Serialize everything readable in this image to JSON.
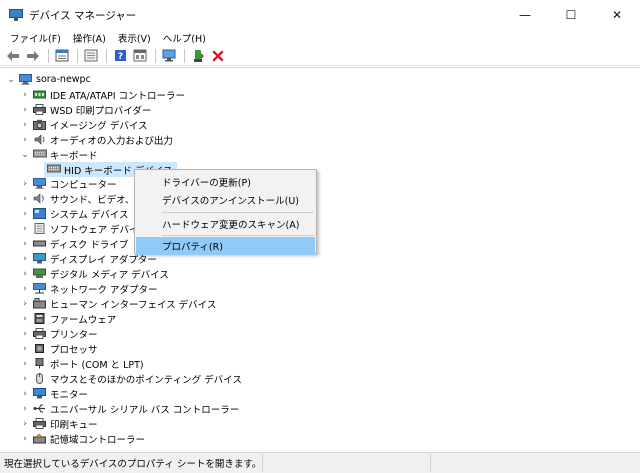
{
  "window": {
    "title": "デバイス マネージャー",
    "minimize_glyph": "—",
    "maximize_glyph": "☐",
    "close_glyph": "✕"
  },
  "menu": [
    "ファイル(F)",
    "操作(A)",
    "表示(V)",
    "ヘルプ(H)"
  ],
  "toolbar": {
    "icons": [
      "back-arrow-icon",
      "forward-arrow-icon",
      "properties-sheet-icon",
      "show-hidden-icon",
      "help-icon",
      "device-view-icon",
      "scan-hardware-icon",
      "enable-device-icon",
      "uninstall-x-icon"
    ]
  },
  "tree": {
    "root": "sora-newpc",
    "expanded_category": "キーボード",
    "selected_device": "HID キーボード デバイス",
    "categories_before": [
      {
        "label": "IDE ATA/ATAPI コントローラー",
        "icon": "ide-controller-icon"
      },
      {
        "label": "WSD 印刷プロバイダー",
        "icon": "printer-icon"
      },
      {
        "label": "イメージング デバイス",
        "icon": "camera-icon"
      },
      {
        "label": "オーディオの入力および出力",
        "icon": "speaker-icon"
      }
    ],
    "categories_after": [
      {
        "label": "コンピューター",
        "icon": "computer-icon"
      },
      {
        "label": "サウンド、ビデオ、およ",
        "icon": "sound-icon"
      },
      {
        "label": "システム デバイス",
        "icon": "system-device-icon"
      },
      {
        "label": "ソフトウェア デバイス",
        "icon": "software-device-icon"
      },
      {
        "label": "ディスク ドライブ",
        "icon": "disk-drive-icon"
      },
      {
        "label": "ディスプレイ アダプター",
        "icon": "display-adapter-icon"
      },
      {
        "label": "デジタル メディア デバイス",
        "icon": "media-device-icon"
      },
      {
        "label": "ネットワーク アダプター",
        "icon": "network-adapter-icon"
      },
      {
        "label": "ヒューマン インターフェイス デバイス",
        "icon": "hid-icon"
      },
      {
        "label": "ファームウェア",
        "icon": "firmware-icon"
      },
      {
        "label": "プリンター",
        "icon": "printer-icon"
      },
      {
        "label": "プロセッサ",
        "icon": "processor-icon"
      },
      {
        "label": "ポート (COM と LPT)",
        "icon": "port-icon"
      },
      {
        "label": "マウスとそのほかのポインティング デバイス",
        "icon": "mouse-icon"
      },
      {
        "label": "モニター",
        "icon": "monitor-icon"
      },
      {
        "label": "ユニバーサル シリアル バス コントローラー",
        "icon": "usb-icon"
      },
      {
        "label": "印刷キュー",
        "icon": "print-queue-icon"
      },
      {
        "label": "記憶域コントローラー",
        "icon": "storage-controller-icon"
      }
    ]
  },
  "context_menu": {
    "items": [
      {
        "label": "ドライバーの更新(P)"
      },
      {
        "label": "デバイスのアンインストール(U)"
      },
      {
        "label": "ハードウェア変更のスキャン(A)"
      },
      {
        "label": "プロパティ(R)"
      }
    ],
    "highlighted_index": 3
  },
  "status": {
    "text": "現在選択しているデバイスのプロパティ シートを開きます。"
  },
  "colors": {
    "highlight": "#91c9f7",
    "selected_item": "#cce8ff",
    "uninstall_red": "#e81123"
  }
}
